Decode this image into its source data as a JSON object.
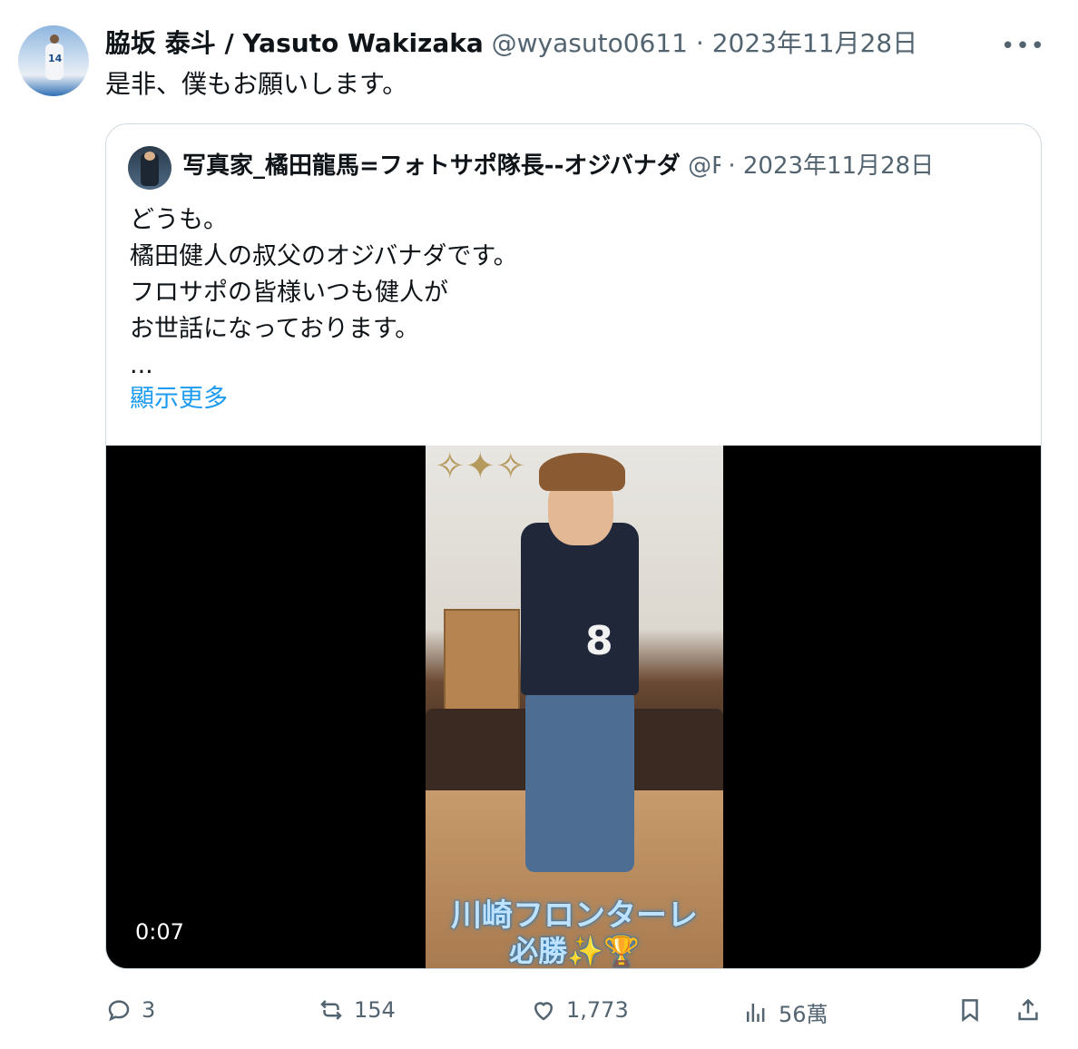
{
  "tweet": {
    "author_name": "脇坂 泰斗 / Yasuto Wakizaka",
    "handle": "@wyasuto0611",
    "separator": " · ",
    "date": "2023年11月28日",
    "text": "是非、僕もお願いします。",
    "more_icon": "•••"
  },
  "quote": {
    "author_name": "写真家_橘田龍馬=フォトサポ隊長--オジバナダ",
    "handle": "@R",
    "separator": " · ",
    "date": "2023年11月28日",
    "lines": [
      "どうも。",
      "橘田健人の叔父のオジバナダです。",
      "フロサポの皆様いつも健人が",
      "お世話になっております。",
      "..."
    ],
    "show_more": "顯示更多",
    "video": {
      "timestamp": "0:07",
      "caption_line1": "川崎フロンターレ",
      "caption_line2": "必勝✨🏆",
      "jersey_number": "8"
    }
  },
  "actions": {
    "replies": "3",
    "retweets": "154",
    "likes": "1,773",
    "views": "56萬"
  }
}
